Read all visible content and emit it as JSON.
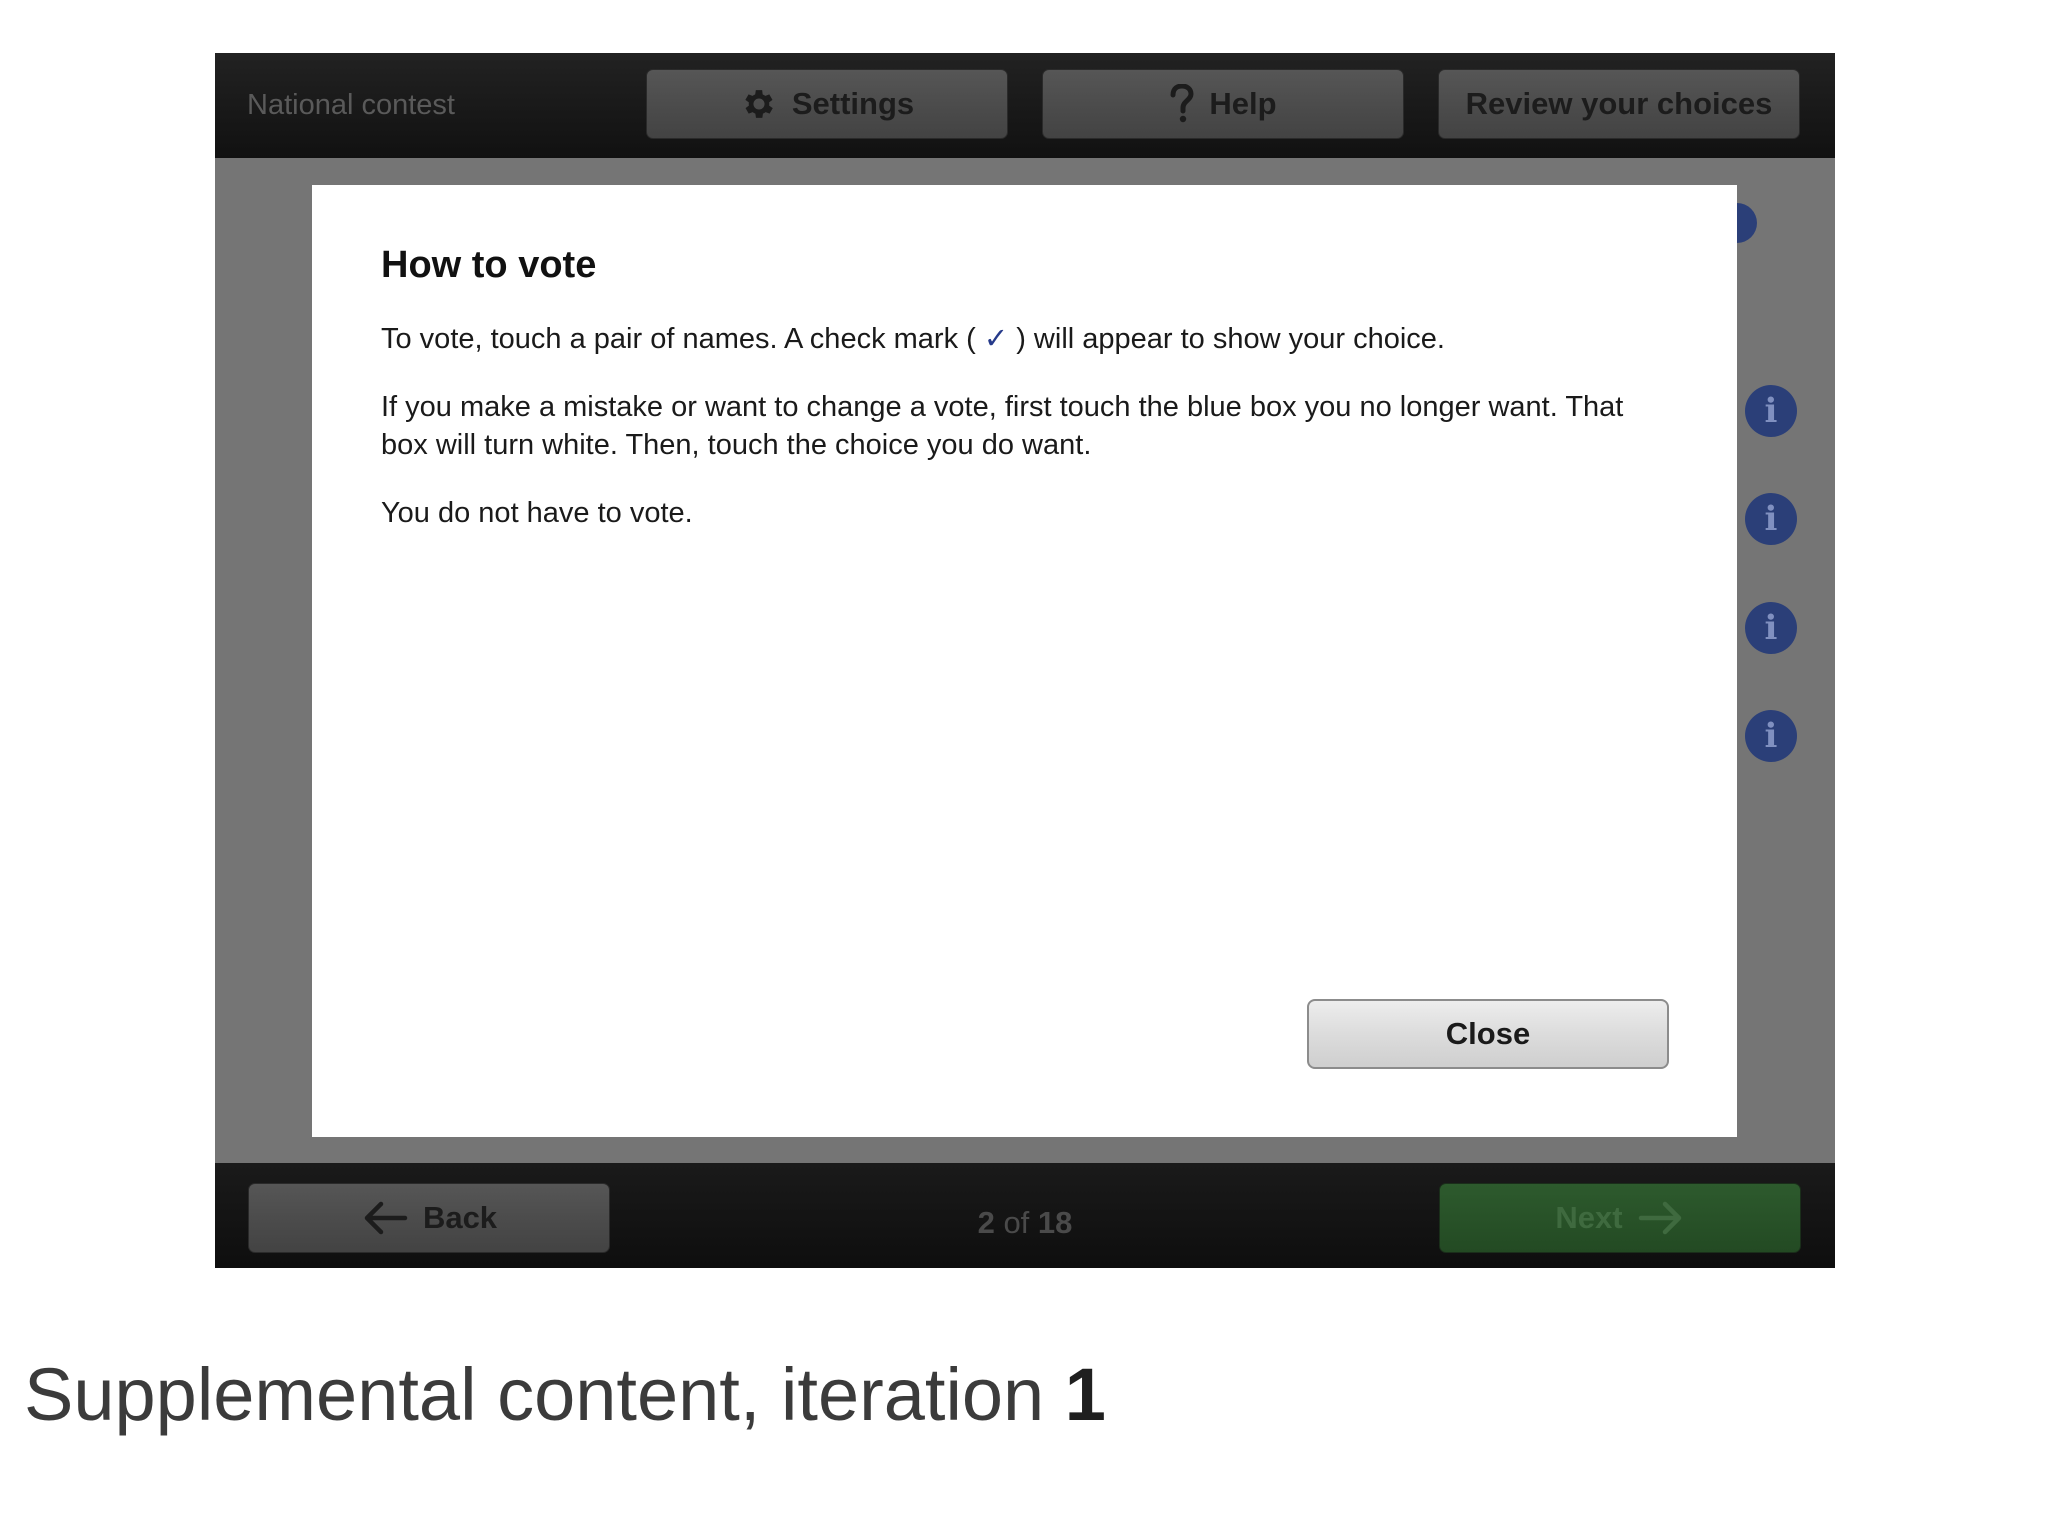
{
  "topbar": {
    "contest_title": "National contest",
    "settings_label": "Settings",
    "help_label": "Help",
    "review_label": "Review your choices"
  },
  "modal": {
    "title": "How to vote",
    "p1_before": "To vote, touch a pair of names. A check mark ( ",
    "check_glyph": "✓",
    "p1_after": " ) will appear to show your choice.",
    "p2": "If you make a mistake or want to change a vote, first touch the blue box you no longer want. That box will turn white. Then, touch the choice you do want.",
    "p3": "You do not have to vote.",
    "close_label": "Close"
  },
  "side_icons": [
    "info-icon",
    "info-icon",
    "info-icon",
    "info-icon"
  ],
  "bottombar": {
    "back_label": "Back",
    "page_current": "2",
    "page_of": " of ",
    "page_total": "18",
    "next_label": "Next"
  },
  "caption": {
    "text": "Supplemental content, iteration ",
    "number": "1"
  },
  "colors": {
    "accent_blue": "#263a8a",
    "next_green": "#2d5a2d"
  }
}
